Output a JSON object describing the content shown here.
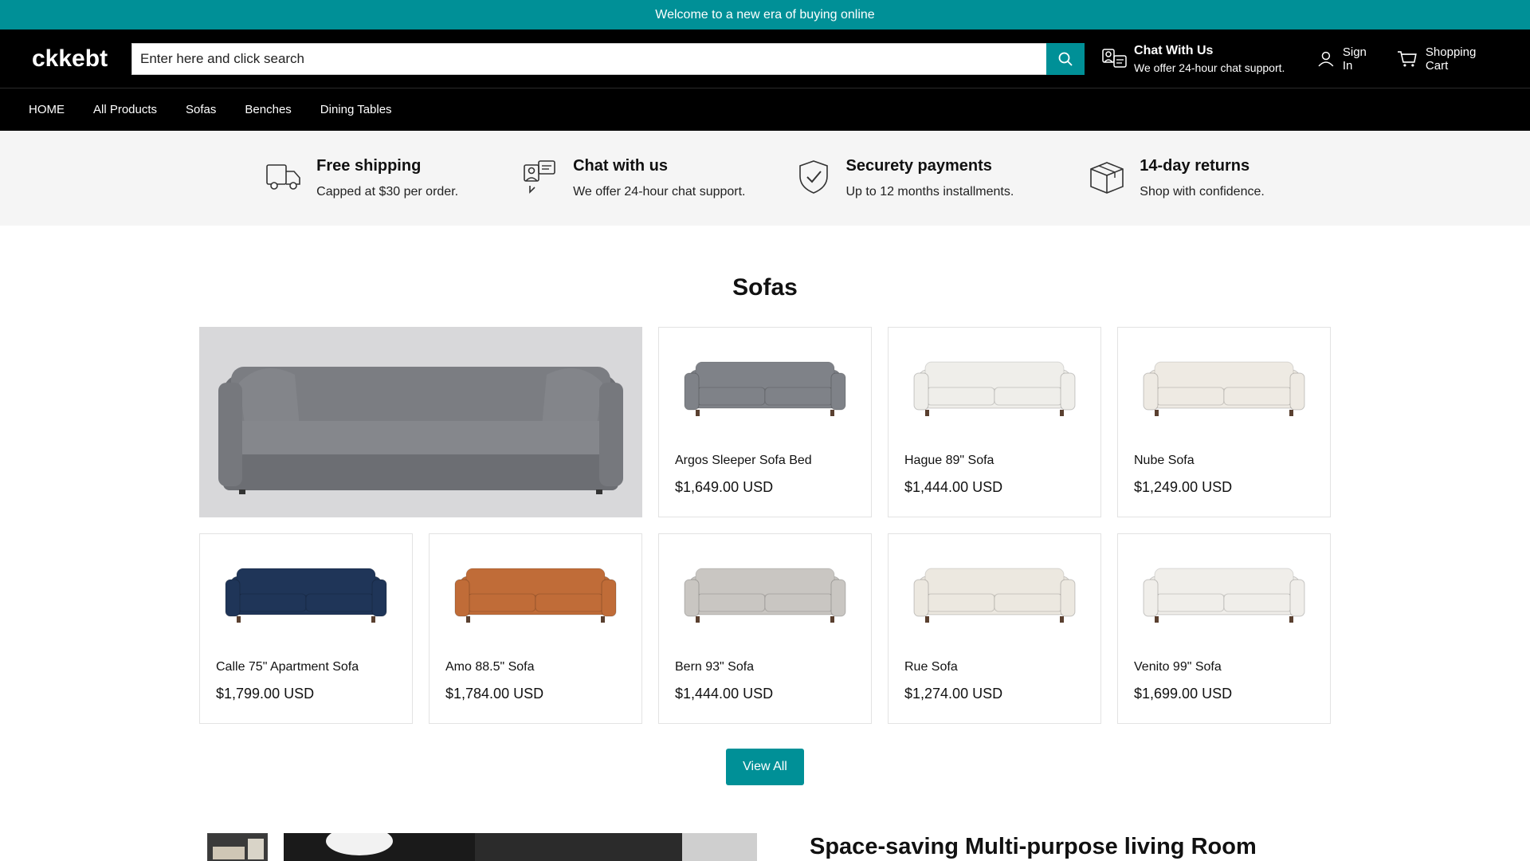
{
  "announcement": "Welcome to a new era of buying online",
  "header": {
    "logo": "ckkebt",
    "search_placeholder": "Enter here and click search",
    "chat_title": "Chat With Us",
    "chat_sub": "We offer 24-hour chat support.",
    "sign_in": "Sign In",
    "cart": "Shopping Cart"
  },
  "nav": [
    "HOME",
    "All Products",
    "Sofas",
    "Benches",
    "Dining Tables"
  ],
  "features": [
    {
      "icon": "truck-icon",
      "title": "Free shipping",
      "sub": "Capped at $30 per order."
    },
    {
      "icon": "chat-icon",
      "title": "Chat with us",
      "sub": "We offer 24-hour chat support."
    },
    {
      "icon": "shield-check-icon",
      "title": "Securety payments",
      "sub": "Up to 12 months installments."
    },
    {
      "icon": "box-icon",
      "title": "14-day returns",
      "sub": "Shop with confidence."
    }
  ],
  "section": {
    "title": "Sofas",
    "view_all": "View All"
  },
  "products": [
    {
      "name": "Argos Sleeper Sofa Bed",
      "price": "$1,649.00 USD",
      "color": "#7f8288"
    },
    {
      "name": "Hague 89\" Sofa",
      "price": "$1,444.00 USD",
      "color": "#efeeea"
    },
    {
      "name": "Nube Sofa",
      "price": "$1,249.00 USD",
      "color": "#eeeae3"
    },
    {
      "name": "Calle 75\" Apartment Sofa",
      "price": "$1,799.00 USD",
      "color": "#1f3558"
    },
    {
      "name": "Amo 88.5\" Sofa",
      "price": "$1,784.00 USD",
      "color": "#c06c38"
    },
    {
      "name": "Bern 93\" Sofa",
      "price": "$1,444.00 USD",
      "color": "#c9c6c2"
    },
    {
      "name": "Rue Sofa",
      "price": "$1,274.00 USD",
      "color": "#ece8e0"
    },
    {
      "name": "Venito 99\" Sofa",
      "price": "$1,699.00 USD",
      "color": "#f0eeea"
    }
  ],
  "promo": {
    "title": "Space-saving Multi-purpose living Room"
  },
  "colors": {
    "accent": "#009097",
    "header_bg": "#000000",
    "feature_bg": "#f5f5f5"
  }
}
